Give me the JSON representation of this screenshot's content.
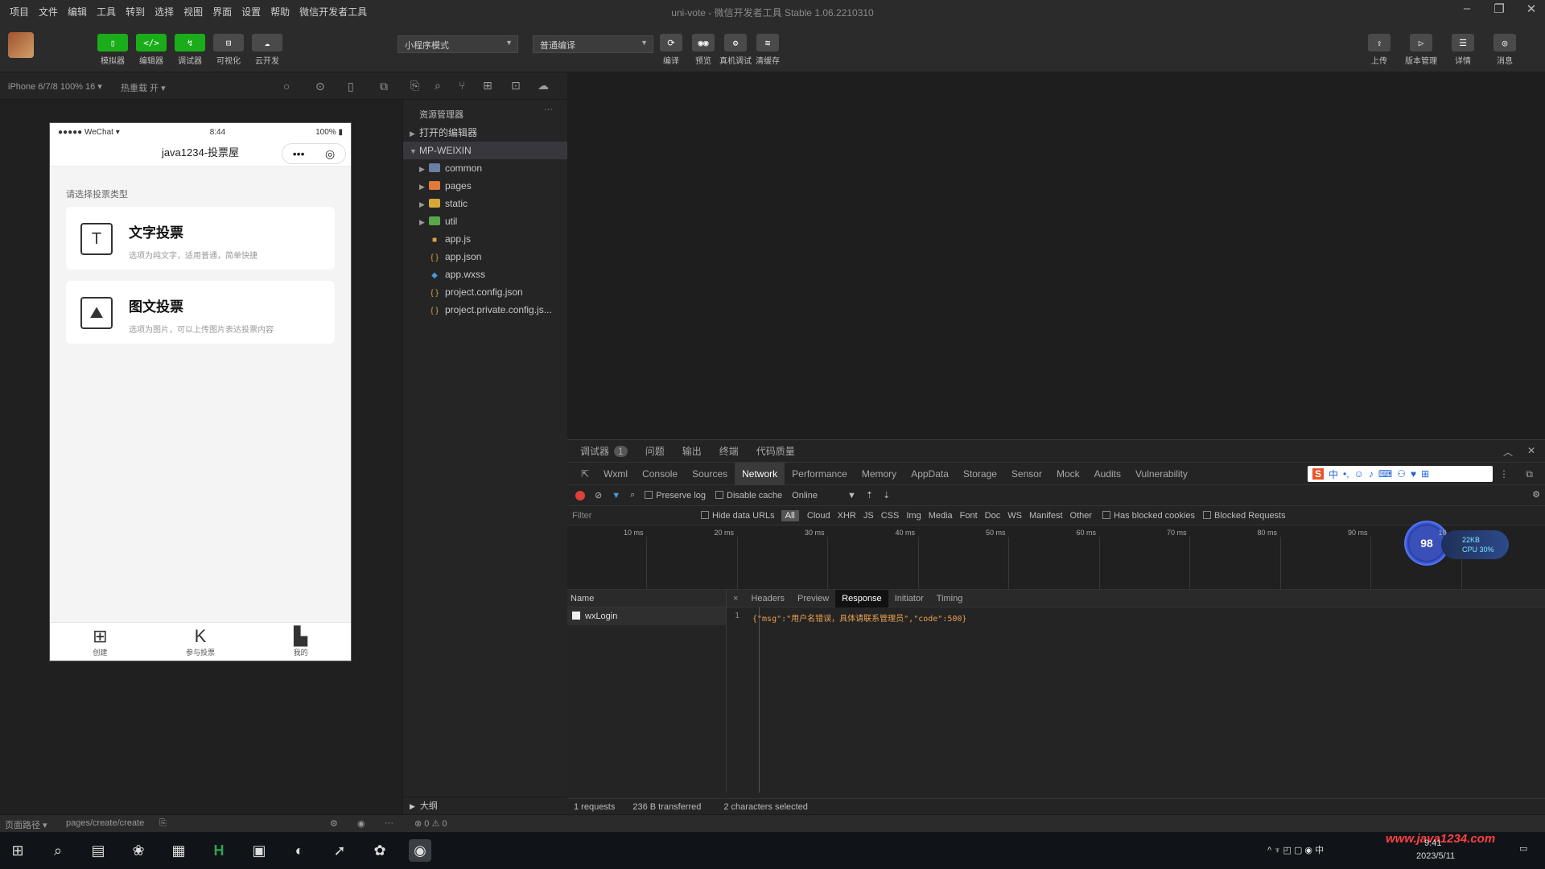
{
  "window": {
    "menus": [
      "项目",
      "文件",
      "编辑",
      "工具",
      "转到",
      "选择",
      "视图",
      "界面",
      "设置",
      "帮助",
      "微信开发者工具"
    ],
    "title": "uni-vote - 微信开发者工具 Stable 1.06.2210310"
  },
  "toolbar": {
    "buttons": [
      {
        "glyph": "▯",
        "label": "模拟器"
      },
      {
        "glyph": "</>",
        "label": "编辑器"
      },
      {
        "glyph": "↯",
        "label": "调试器"
      },
      {
        "glyph": "⊟",
        "label": "可视化"
      },
      {
        "glyph": "☁",
        "label": "云开发"
      }
    ],
    "mode_select": "小程序模式",
    "compile_select": "普通编译",
    "actions": [
      {
        "glyph": "⟳",
        "label": "编译"
      },
      {
        "glyph": "◉◉",
        "label": "预览"
      },
      {
        "glyph": "⚙",
        "label": "真机调试"
      },
      {
        "glyph": "≋",
        "label": "清缓存"
      }
    ],
    "right_actions": [
      {
        "glyph": "⇪",
        "label": "上传"
      },
      {
        "glyph": "▷",
        "label": "版本管理"
      },
      {
        "glyph": "☰",
        "label": "详情"
      },
      {
        "glyph": "◎",
        "label": "消息"
      }
    ]
  },
  "subbar": {
    "device": "iPhone 6/7/8 100% 16 ▾",
    "hotreload": "热重载 开 ▾"
  },
  "phone": {
    "status_left": "●●●●● WeChat ▾",
    "status_time": "8:44",
    "status_right": "100% ▮",
    "nav_title": "java1234-投票屋",
    "capsule_more": "•••",
    "capsule_close": "◎",
    "section": "请选择投票类型",
    "cards": [
      {
        "icon": "T",
        "title": "文字投票",
        "desc": "选项为纯文字，适用普通，简单快捷"
      },
      {
        "icon": "⛰",
        "title": "图文投票",
        "desc": "选项为图片，可以上传图片表达投票内容"
      }
    ],
    "tabs": [
      {
        "icon": "⊞",
        "label": "创建"
      },
      {
        "icon": "K",
        "label": "参与投票"
      },
      {
        "icon": "▙",
        "label": "我的"
      }
    ]
  },
  "explorer": {
    "title": "资源管理器",
    "more": "···",
    "open_editors": "打开的编辑器",
    "project": "MP-WEIXIN",
    "items": [
      {
        "name": "common",
        "kind": "folder",
        "color": "#6b7fa3",
        "expandable": true
      },
      {
        "name": "pages",
        "kind": "folder",
        "color": "#e0793a",
        "expandable": true
      },
      {
        "name": "static",
        "kind": "folder",
        "color": "#d8a63a",
        "expandable": true
      },
      {
        "name": "util",
        "kind": "folder",
        "color": "#58a84a",
        "expandable": true
      },
      {
        "name": "app.js",
        "kind": "js",
        "color": "#d8a63a",
        "expandable": false
      },
      {
        "name": "app.json",
        "kind": "json",
        "color": "#d8a63a",
        "expandable": false
      },
      {
        "name": "app.wxss",
        "kind": "wxss",
        "color": "#4a9ad8",
        "expandable": false
      },
      {
        "name": "project.config.json",
        "kind": "json",
        "color": "#d8a63a",
        "expandable": false
      },
      {
        "name": "project.private.config.js...",
        "kind": "json",
        "color": "#d8a63a",
        "expandable": false
      }
    ],
    "outline": "大纲"
  },
  "devtools": {
    "top_tabs": [
      {
        "label": "调试器",
        "badge": "1",
        "active": true
      },
      {
        "label": "问题",
        "badge": "",
        "active": false
      },
      {
        "label": "输出",
        "badge": "",
        "active": false
      },
      {
        "label": "终端",
        "badge": "",
        "active": false
      },
      {
        "label": "代码质量",
        "badge": "",
        "active": false
      }
    ],
    "panel_tabs": [
      {
        "label": "Wxml",
        "active": false
      },
      {
        "label": "Console",
        "active": false
      },
      {
        "label": "Sources",
        "active": false
      },
      {
        "label": "Network",
        "active": true
      },
      {
        "label": "Performance",
        "active": false
      },
      {
        "label": "Memory",
        "active": false
      },
      {
        "label": "AppData",
        "active": false
      },
      {
        "label": "Storage",
        "active": false
      },
      {
        "label": "Sensor",
        "active": false
      },
      {
        "label": "Mock",
        "active": false
      },
      {
        "label": "Audits",
        "active": false
      },
      {
        "label": "Vulnerability",
        "active": false
      }
    ],
    "ime_glyphs": [
      "S",
      "中",
      "•,",
      "☺",
      "♪",
      "⌨",
      "⚇",
      "♥",
      "⊞"
    ],
    "controls": {
      "preserve_log": "Preserve log",
      "disable_cache": "Disable cache",
      "throttle": "Online"
    },
    "filter": {
      "label": "Filter",
      "hide_data_urls": "Hide data URLs",
      "all": "All",
      "types": [
        "Cloud",
        "XHR",
        "JS",
        "CSS",
        "Img",
        "Media",
        "Font",
        "Doc",
        "WS",
        "Manifest",
        "Other"
      ],
      "blocked_cookies": "Has blocked cookies",
      "blocked_requests": "Blocked Requests"
    },
    "timeline_ticks": [
      "10 ms",
      "20 ms",
      "30 ms",
      "40 ms",
      "50 ms",
      "60 ms",
      "70 ms",
      "80 ms",
      "90 ms",
      "10"
    ],
    "perf": {
      "score": "98",
      "line1": "22KB",
      "line2": "CPU 30%"
    },
    "name_header": "Name",
    "requests": [
      "wxLogin"
    ],
    "detail_close": "×",
    "detail_tabs": [
      {
        "label": "Headers",
        "active": false
      },
      {
        "label": "Preview",
        "active": false
      },
      {
        "label": "Response",
        "active": true
      },
      {
        "label": "Initiator",
        "active": false
      },
      {
        "label": "Timing",
        "active": false
      }
    ],
    "response_line_no": "1",
    "response_text": "{\"msg\":\"用户名错误，具体请联系管理员\",\"code\":500}",
    "footer_requests": "1 requests",
    "footer_transferred": "236 B transferred",
    "footer_selection": "2 characters selected"
  },
  "statusbar": {
    "left": "页面路径 ▾",
    "path": "pages/create/create",
    "errors": "⊗ 0 ⚠ 0"
  },
  "taskbar": {
    "icons": [
      "⊞",
      "⌕",
      "▤",
      "❀",
      "▦",
      "H",
      "▣",
      "◐",
      "➚",
      "✿",
      "◉"
    ],
    "tray": "^ ♆ ◰ ▢ ◉ 中",
    "time": "9:41",
    "date": "2023/5/11",
    "watermark": "www.java1234.com"
  }
}
